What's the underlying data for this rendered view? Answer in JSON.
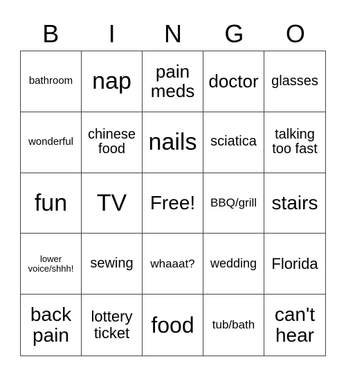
{
  "header": [
    "B",
    "I",
    "N",
    "G",
    "O"
  ],
  "cells": [
    "bathroom",
    "nap",
    "pain meds",
    "doctor",
    "glasses",
    "wonderful",
    "chinese food",
    "nails",
    "sciatica",
    "talking too fast",
    "fun",
    "TV",
    "Free!",
    "BBQ/grill",
    "stairs",
    "lower voice/shhh!",
    "sewing",
    "whaaat?",
    "wedding",
    "Florida",
    "back pain",
    "lottery ticket",
    "food",
    "tub/bath",
    "can't hear"
  ]
}
